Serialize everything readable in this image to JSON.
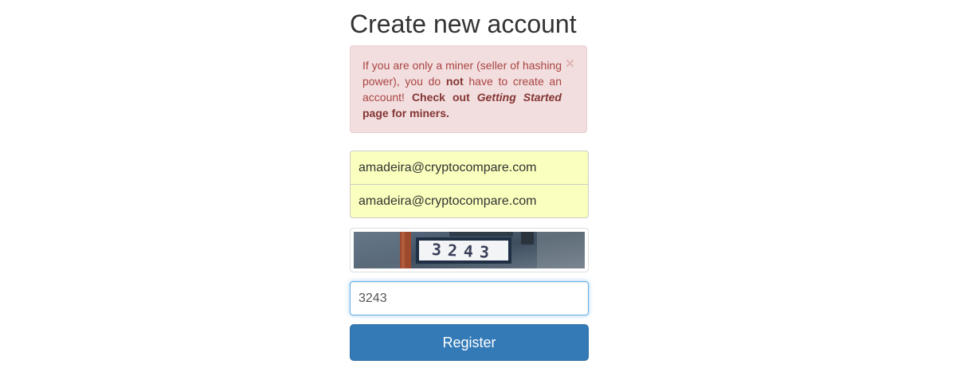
{
  "page": {
    "title": "Create new account"
  },
  "alert": {
    "text_1": "If you are only a miner (seller of hashing power), you do ",
    "emph_not": "not",
    "text_2": " have to create an account! ",
    "bold_1": "Check out ",
    "bold_italic": "Getting Started",
    "bold_2": " page for miners.",
    "close_symbol": "×"
  },
  "form": {
    "email_value": "amadeira@cryptocompare.com",
    "email_confirm_value": "amadeira@cryptocompare.com",
    "captcha_image_text": "3243",
    "captcha_input_value": "3243",
    "register_label": "Register"
  },
  "colors": {
    "alert_bg": "#f2dede",
    "alert_text": "#a94442",
    "autofill_bg": "#faffbd",
    "primary": "#337ab7"
  }
}
